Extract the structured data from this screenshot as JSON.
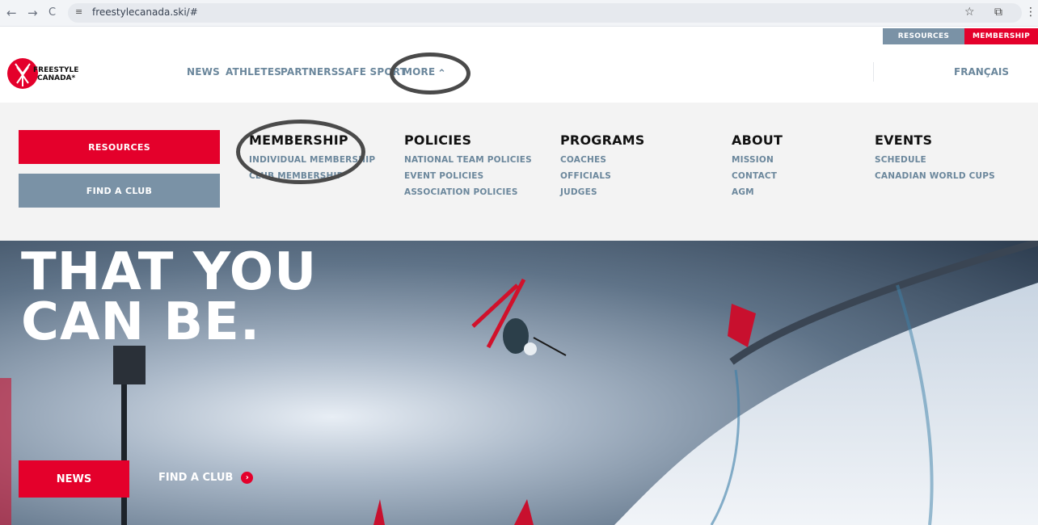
{
  "browser": {
    "url": "freestylecanada.ski/#",
    "back_icon": "←",
    "forward_icon": "→",
    "reload_icon": "C",
    "site_icon": "≡",
    "bookmark_icon": "☆",
    "extensions_icon": "⧉",
    "menu_icon": "⋮"
  },
  "utility_bar": {
    "resources": "RESOURCES",
    "membership": "MEMBERSHIP"
  },
  "header": {
    "logo_text_1": "FREESTYLE",
    "logo_text_2": "CANADA*",
    "nav": [
      "NEWS",
      "ATHLETES",
      "PARTNERS",
      "SAFE SPORT",
      "MORE"
    ],
    "more_chevron": "⌃",
    "language": "FRANÇAIS"
  },
  "mega_menu": {
    "cta_resources": "RESOURCES",
    "cta_find_club": "FIND A CLUB",
    "columns": [
      {
        "head": "MEMBERSHIP",
        "links": [
          "INDIVIDUAL MEMBERSHIP",
          "CLUB MEMBERSHIP"
        ]
      },
      {
        "head": "POLICIES",
        "links": [
          "NATIONAL TEAM POLICIES",
          "EVENT POLICIES",
          "ASSOCIATION POLICIES"
        ]
      },
      {
        "head": "PROGRAMS",
        "links": [
          "COACHES",
          "OFFICIALS",
          "JUDGES"
        ]
      },
      {
        "head": "ABOUT",
        "links": [
          "MISSION",
          "CONTACT",
          "AGM"
        ]
      },
      {
        "head": "EVENTS",
        "links": [
          "SCHEDULE",
          "CANADIAN WORLD CUPS"
        ]
      }
    ]
  },
  "hero": {
    "title_line_1": "THAT YOU",
    "title_line_2": "CAN BE.",
    "news_button": "NEWS",
    "find_club_link": "FIND A CLUB",
    "arrow_icon": "›"
  },
  "colors": {
    "brand_red": "#e4002b",
    "slate_blue": "#7a92a6",
    "nav_text": "#6b879c"
  }
}
